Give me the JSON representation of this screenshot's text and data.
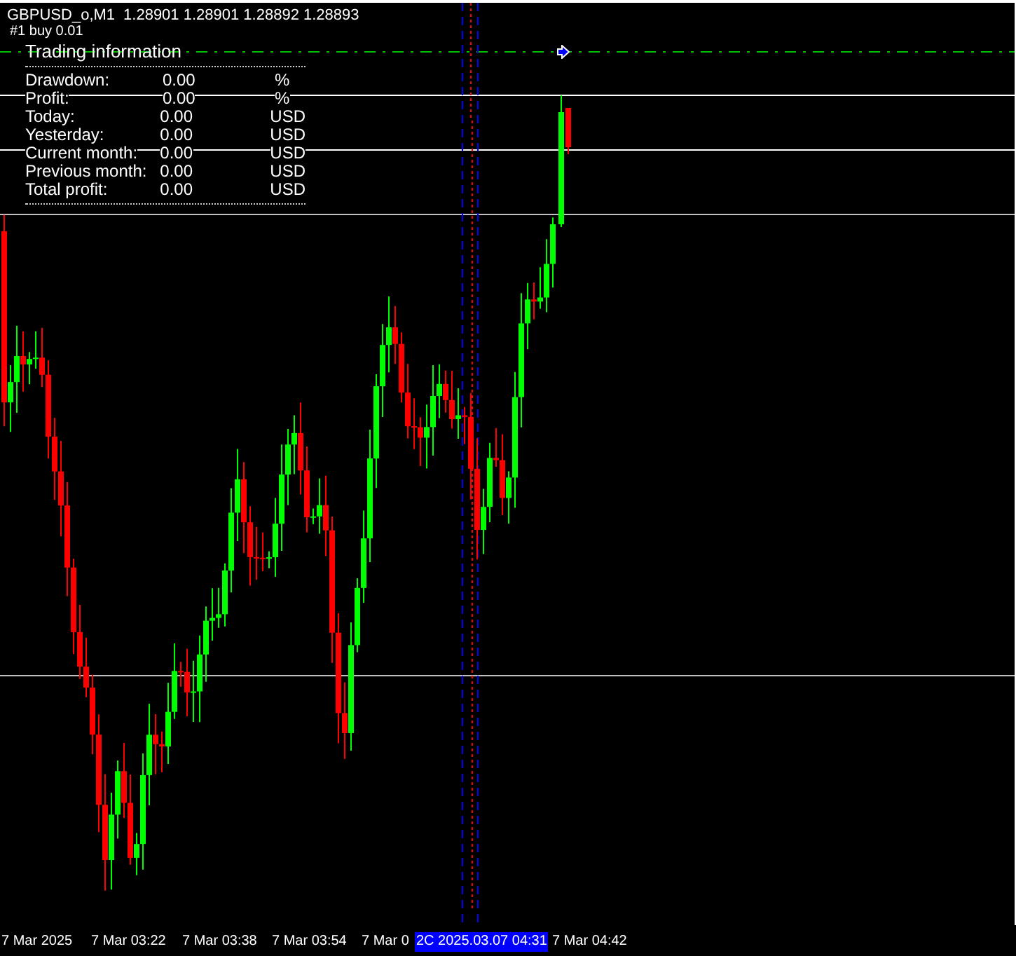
{
  "header": {
    "symbol": "GBPUSD_o,M1",
    "prices": "1.28901 1.28901 1.28892 1.28893"
  },
  "trade_label": "#1 buy 0.01",
  "info": {
    "title": "Trading information",
    "rows": [
      {
        "label": "Drawdown:",
        "value": "0.00",
        "unit": "%"
      },
      {
        "label": "Profit:",
        "value": "0.00",
        "unit": "%"
      },
      {
        "label": "Today:",
        "value": "0.00",
        "unit": "USD"
      },
      {
        "label": "Yesterday:",
        "value": "0.00",
        "unit": "USD"
      },
      {
        "label": "Current month:",
        "value": "0.00",
        "unit": "USD"
      },
      {
        "label": "Previous month:",
        "value": "0.00",
        "unit": "USD"
      },
      {
        "label": "Total profit:",
        "value": "0.00",
        "unit": "USD"
      }
    ]
  },
  "time_axis": [
    {
      "kind": "tick",
      "label": "7 Mar 2025"
    },
    {
      "kind": "tick",
      "label": "7 Mar 03:22"
    },
    {
      "kind": "tick",
      "label": "7 Mar 03:38"
    },
    {
      "kind": "tick",
      "label": "7 Mar 03:54"
    },
    {
      "kind": "tick",
      "label": "7 Mar 0"
    },
    {
      "kind": "cursor",
      "label": "2C 2025.03.07 04:31"
    },
    {
      "kind": "tick",
      "label": "7 Mar 04:42"
    }
  ]
}
